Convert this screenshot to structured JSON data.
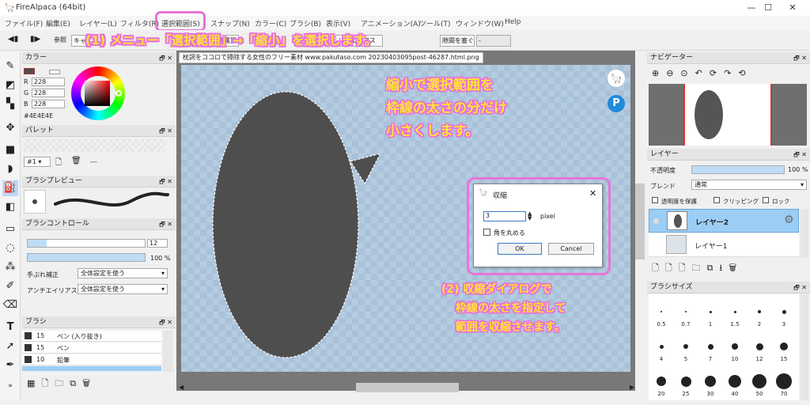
{
  "app": {
    "title": "FireAlpaca (64bit)",
    "minimize": "—",
    "maximize": "☐",
    "close": "✕"
  },
  "menu": [
    "ファイル(F)",
    "編集(E)",
    "レイヤー(L)",
    "フィルタ(R)",
    "選択範囲(S)",
    "スナップ(N)",
    "カラー(C)",
    "ブラシ(B)",
    "表示(V)",
    "アニメーション(A)",
    "ツール(T)",
    "ウィンドウ(W)",
    "Help"
  ],
  "toolbar": {
    "ref_label": "参照",
    "ref_value": "キャ",
    "hidden1": "隠する",
    "hidden2": "隠属置",
    "aa_label": "ンチエリアス",
    "gap_label": "隙間を塞ぐ",
    "gap_value": "-"
  },
  "annotations": {
    "step1": "(1) メニュー「選択範囲」→「縮小」を選択します。",
    "note_lines": [
      "縮小で選択範囲を",
      "枠線の太さの分だけ",
      "小さくします。"
    ],
    "step2_lines": [
      "(2) 収縮ダイアログで",
      "枠線の太さを指定して",
      "範囲を収縮させます。"
    ]
  },
  "document_tab": "枕詞をココロで掃除する女性のフリー素材 www.pakutaso.com 20230403095post-46287.html.png",
  "color_panel": {
    "title": "カラー",
    "r_label": "R",
    "r_value": "228",
    "g_label": "G",
    "g_value": "228",
    "b_label": "B",
    "b_value": "228",
    "hex": "#4E4E4E"
  },
  "palette_panel": {
    "title": "パレット",
    "selector": "#1",
    "dash": "---"
  },
  "brush_preview_panel": {
    "title": "ブラシプレビュー"
  },
  "brush_control_panel": {
    "title": "ブラシコントロール",
    "size": "12",
    "opacity": "100 %",
    "stabilizer_label": "手ぶれ補正",
    "stabilizer_value": "全体設定を使う",
    "aa_label": "アンチエイリアス",
    "aa_value": "全体設定を使う"
  },
  "brush_panel": {
    "title": "ブラシ",
    "items": [
      {
        "size": "15",
        "name": "ペン (入り抜き)"
      },
      {
        "size": "15",
        "name": "ペン"
      },
      {
        "size": "10",
        "name": "鉛筆"
      }
    ]
  },
  "dialog": {
    "title": "収縮",
    "value": "3",
    "unit": "pixel",
    "checkbox": "角を丸める",
    "ok": "OK",
    "cancel": "Cancel"
  },
  "navigator": {
    "title": "ナビゲーター"
  },
  "layer_panel": {
    "title": "レイヤー",
    "opacity_label": "不透明度",
    "opacity_value": "100 %",
    "opacity_fraction": 1.0,
    "blend_label": "ブレンド",
    "blend_value": "通常",
    "protect_label": "透明度を保護",
    "clipping_label": "クリッピング",
    "lock_label": "ロック",
    "layers": [
      "レイヤー2",
      "レイヤー1"
    ]
  },
  "brush_size_panel": {
    "title": "ブラシサイズ",
    "sizes": [
      "0.5",
      "0.7",
      "1",
      "1.5",
      "2",
      "3",
      "4",
      "5",
      "7",
      "10",
      "12",
      "15",
      "20",
      "25",
      "30",
      "40",
      "50",
      "70"
    ]
  },
  "colors": {
    "accent_pink": "#e96fd9",
    "annotation_yellow": "#ffe23a",
    "selected_blue": "#9ccdf5",
    "balloon": "#4e4e4e"
  }
}
